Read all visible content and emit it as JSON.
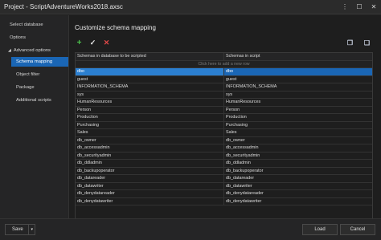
{
  "window": {
    "title": "Project - ScriptAdventureWorks2018.axsc",
    "menu_icon": "⋮",
    "maximize_icon": "☐",
    "close_icon": "✕"
  },
  "sidebar": {
    "items": [
      {
        "label": "Select database"
      },
      {
        "label": "Options"
      }
    ],
    "group": {
      "label": "Advanced options",
      "caret": "◢"
    },
    "subitems": [
      {
        "label": "Schema mapping"
      },
      {
        "label": "Object filter"
      },
      {
        "label": "Package"
      },
      {
        "label": "Additional scripts"
      }
    ]
  },
  "main": {
    "heading": "Customize schema mapping",
    "toolbar": {
      "add": "+",
      "apply": "✓",
      "delete": "✕",
      "right1": "❐",
      "right2": "❏"
    },
    "grid": {
      "columns": [
        "Schemas in database to be scripted",
        "Schemas in script"
      ],
      "new_row_placeholder": "Click here to add a new row",
      "rows": [
        [
          "dbo",
          "dbo"
        ],
        [
          "guest",
          "guest"
        ],
        [
          "INFORMATION_SCHEMA",
          "INFORMATION_SCHEMA"
        ],
        [
          "sys",
          "sys"
        ],
        [
          "HumanResources",
          "HumanResources"
        ],
        [
          "Person",
          "Person"
        ],
        [
          "Production",
          "Production"
        ],
        [
          "Purchasing",
          "Purchasing"
        ],
        [
          "Sales",
          "Sales"
        ],
        [
          "db_owner",
          "db_owner"
        ],
        [
          "db_accessadmin",
          "db_accessadmin"
        ],
        [
          "db_securityadmin",
          "db_securityadmin"
        ],
        [
          "db_ddladmin",
          "db_ddladmin"
        ],
        [
          "db_backupoperator",
          "db_backupoperator"
        ],
        [
          "db_datareader",
          "db_datareader"
        ],
        [
          "db_datawriter",
          "db_datawriter"
        ],
        [
          "db_denydatareader",
          "db_denydatareader"
        ],
        [
          "db_denydatawriter",
          "db_denydatawriter"
        ]
      ]
    }
  },
  "footer": {
    "save_label": "Save",
    "save_caret": "▾",
    "load_label": "Load",
    "cancel_label": "Cancel"
  }
}
